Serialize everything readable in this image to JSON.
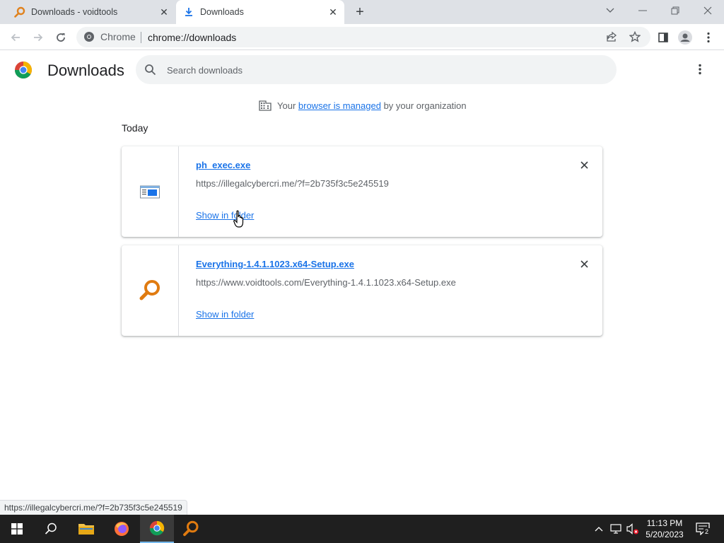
{
  "tabs": [
    {
      "title": "Downloads - voidtools",
      "favicon": "voidtools-magnifier-icon",
      "active": false
    },
    {
      "title": "Downloads",
      "favicon": "download-arrow-icon",
      "active": true
    }
  ],
  "toolbar": {
    "chip_label": "Chrome",
    "url": "chrome://downloads"
  },
  "downloads_page": {
    "title": "Downloads",
    "search_placeholder": "Search downloads",
    "managed": {
      "prefix": "Your ",
      "link": "browser is managed",
      "suffix": " by your organization"
    },
    "section_label": "Today",
    "items": [
      {
        "file_name": "ph_exec.exe",
        "url": "https://illegalcybercri.me/?f=2b735f3c5e245519",
        "action_label": "Show in folder",
        "icon": "exe-window-icon"
      },
      {
        "file_name": "Everything-1.4.1.1023.x64-Setup.exe",
        "url": "https://www.voidtools.com/Everything-1.4.1.1023.x64-Setup.exe",
        "action_label": "Show in folder",
        "icon": "everything-magnifier-icon"
      }
    ]
  },
  "status_bar": {
    "text": "https://illegalcybercri.me/?f=2b735f3c5e245519"
  },
  "taskbar": {
    "time": "11:13 PM",
    "date": "5/20/2023",
    "notification_count": "2"
  },
  "colors": {
    "accent": "#1a73e8",
    "tabstrip": "#dee1e6",
    "taskbar": "#1f1f1f"
  }
}
